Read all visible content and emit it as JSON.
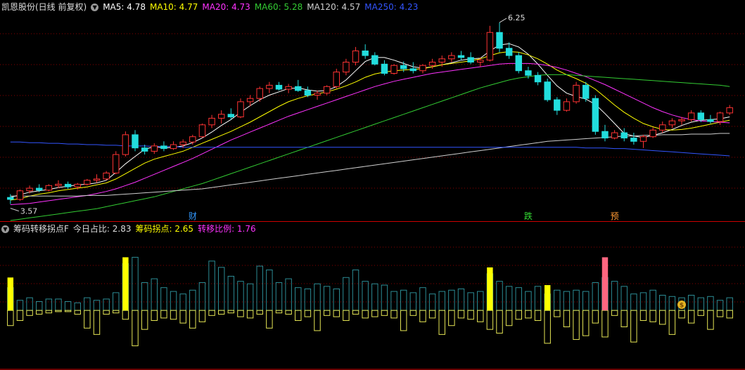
{
  "stock_title": "凯恩股份(日线 前复权)",
  "ma_legend": [
    {
      "label": "MA5: 4.78",
      "color": "#ffffff"
    },
    {
      "label": "MA10: 4.77",
      "color": "#ffff00"
    },
    {
      "label": "MA20: 4.73",
      "color": "#ff33ff"
    },
    {
      "label": "MA60: 5.28",
      "color": "#33cc33"
    },
    {
      "label": "MA120: 4.57",
      "color": "#cfcfcf"
    },
    {
      "label": "MA250: 4.23",
      "color": "#3355ff"
    }
  ],
  "indicator_title": "筹码转移拐点F",
  "indicator_legend": [
    {
      "label": "今日占比: 2.83",
      "color": "#dddddd"
    },
    {
      "label": "筹码拐点: 2.65",
      "color": "#ffff00"
    },
    {
      "label": "转移比例: 1.76",
      "color": "#ff33ff"
    }
  ],
  "annotations": {
    "high_label": "6.25",
    "low_label": "3.57",
    "markers": [
      {
        "text": "财",
        "index": 19,
        "color": "#3399ff"
      },
      {
        "text": "跌",
        "index": 54,
        "color": "#33dd33"
      },
      {
        "text": "预",
        "index": 63,
        "color": "#ff9933"
      }
    ]
  },
  "colors": {
    "up": "#ff3333",
    "down": "#22dddd",
    "grid": "#880000",
    "divider": "#cc0000"
  },
  "icons": {
    "collapse": "chevron-down-icon",
    "money_bag": "money-bag-icon"
  },
  "chart_data": [
    {
      "type": "candlestick",
      "name": "price",
      "ylim": [
        3.4,
        6.4
      ],
      "candles": [
        [
          3.6,
          3.65,
          3.5,
          3.57
        ],
        [
          3.57,
          3.72,
          3.55,
          3.7
        ],
        [
          3.7,
          3.78,
          3.66,
          3.74
        ],
        [
          3.74,
          3.8,
          3.68,
          3.71
        ],
        [
          3.71,
          3.8,
          3.69,
          3.78
        ],
        [
          3.78,
          3.86,
          3.74,
          3.8
        ],
        [
          3.8,
          3.84,
          3.73,
          3.76
        ],
        [
          3.76,
          3.82,
          3.72,
          3.8
        ],
        [
          3.8,
          3.88,
          3.78,
          3.86
        ],
        [
          3.86,
          3.95,
          3.82,
          3.88
        ],
        [
          3.88,
          4.0,
          3.86,
          3.97
        ],
        [
          3.97,
          4.3,
          3.95,
          4.25
        ],
        [
          4.25,
          4.6,
          4.22,
          4.55
        ],
        [
          4.55,
          4.62,
          4.3,
          4.35
        ],
        [
          4.35,
          4.4,
          4.25,
          4.3
        ],
        [
          4.3,
          4.42,
          4.26,
          4.38
        ],
        [
          4.38,
          4.45,
          4.3,
          4.34
        ],
        [
          4.34,
          4.45,
          4.32,
          4.4
        ],
        [
          4.4,
          4.48,
          4.35,
          4.44
        ],
        [
          4.44,
          4.55,
          4.4,
          4.52
        ],
        [
          4.52,
          4.72,
          4.5,
          4.7
        ],
        [
          4.7,
          4.85,
          4.65,
          4.8
        ],
        [
          4.8,
          4.92,
          4.72,
          4.86
        ],
        [
          4.86,
          4.95,
          4.78,
          4.82
        ],
        [
          4.82,
          5.1,
          4.8,
          5.05
        ],
        [
          5.05,
          5.15,
          4.98,
          5.1
        ],
        [
          5.1,
          5.28,
          5.05,
          5.25
        ],
        [
          5.25,
          5.35,
          5.18,
          5.3
        ],
        [
          5.3,
          5.35,
          5.22,
          5.24
        ],
        [
          5.24,
          5.32,
          5.18,
          5.28
        ],
        [
          5.28,
          5.38,
          5.2,
          5.22
        ],
        [
          5.22,
          5.28,
          5.12,
          5.15
        ],
        [
          5.15,
          5.22,
          5.08,
          5.18
        ],
        [
          5.18,
          5.3,
          5.15,
          5.28
        ],
        [
          5.28,
          5.55,
          5.25,
          5.5
        ],
        [
          5.5,
          5.7,
          5.45,
          5.65
        ],
        [
          5.65,
          5.88,
          5.6,
          5.82
        ],
        [
          5.82,
          5.92,
          5.7,
          5.75
        ],
        [
          5.75,
          5.8,
          5.6,
          5.62
        ],
        [
          5.62,
          5.68,
          5.45,
          5.48
        ],
        [
          5.48,
          5.62,
          5.46,
          5.6
        ],
        [
          5.6,
          5.66,
          5.5,
          5.55
        ],
        [
          5.55,
          5.65,
          5.48,
          5.52
        ],
        [
          5.52,
          5.62,
          5.48,
          5.6
        ],
        [
          5.6,
          5.7,
          5.55,
          5.65
        ],
        [
          5.65,
          5.75,
          5.58,
          5.7
        ],
        [
          5.7,
          5.8,
          5.65,
          5.75
        ],
        [
          5.75,
          5.82,
          5.68,
          5.72
        ],
        [
          5.72,
          5.8,
          5.62,
          5.65
        ],
        [
          5.65,
          5.72,
          5.58,
          5.68
        ],
        [
          5.68,
          6.2,
          5.66,
          6.1
        ],
        [
          6.1,
          6.25,
          5.8,
          5.86
        ],
        [
          5.86,
          5.95,
          5.7,
          5.75
        ],
        [
          5.75,
          5.8,
          5.48,
          5.52
        ],
        [
          5.52,
          5.58,
          5.4,
          5.45
        ],
        [
          5.45,
          5.5,
          5.3,
          5.35
        ],
        [
          5.35,
          5.4,
          5.05,
          5.08
        ],
        [
          5.08,
          5.12,
          4.85,
          4.92
        ],
        [
          4.92,
          5.1,
          4.9,
          5.05
        ],
        [
          5.05,
          5.35,
          5.02,
          5.3
        ],
        [
          5.3,
          5.35,
          5.05,
          5.1
        ],
        [
          5.1,
          5.15,
          4.55,
          4.6
        ],
        [
          4.6,
          4.7,
          4.45,
          4.5
        ],
        [
          4.5,
          4.62,
          4.48,
          4.58
        ],
        [
          4.58,
          4.65,
          4.45,
          4.5
        ],
        [
          4.5,
          4.58,
          4.4,
          4.45
        ],
        [
          4.45,
          4.55,
          4.35,
          4.52
        ],
        [
          4.52,
          4.66,
          4.5,
          4.62
        ],
        [
          4.62,
          4.75,
          4.58,
          4.7
        ],
        [
          4.7,
          4.8,
          4.65,
          4.76
        ],
        [
          4.76,
          4.82,
          4.7,
          4.78
        ],
        [
          4.78,
          4.92,
          4.75,
          4.88
        ],
        [
          4.88,
          4.92,
          4.74,
          4.78
        ],
        [
          4.78,
          4.85,
          4.72,
          4.75
        ],
        [
          4.75,
          4.9,
          4.7,
          4.88
        ],
        [
          4.88,
          5.0,
          4.85,
          4.96
        ]
      ],
      "ma_series": [
        {
          "name": "MA5",
          "color": "#ffffff",
          "values": [
            3.6,
            3.64,
            3.68,
            3.7,
            3.72,
            3.75,
            3.77,
            3.79,
            3.8,
            3.82,
            3.86,
            3.98,
            4.11,
            4.22,
            4.33,
            4.37,
            4.35,
            4.36,
            4.38,
            4.43,
            4.5,
            4.59,
            4.69,
            4.78,
            4.89,
            4.99,
            5.08,
            5.15,
            5.2,
            5.25,
            5.26,
            5.23,
            5.21,
            5.22,
            5.28,
            5.38,
            5.52,
            5.66,
            5.72,
            5.72,
            5.68,
            5.63,
            5.58,
            5.56,
            5.58,
            5.61,
            5.64,
            5.68,
            5.7,
            5.71,
            5.82,
            5.91,
            5.93,
            5.88,
            5.77,
            5.62,
            5.45,
            5.29,
            5.18,
            5.13,
            5.09,
            5.01,
            4.87,
            4.72,
            4.57,
            4.53,
            4.51,
            4.54,
            4.58,
            4.63,
            4.69,
            4.74,
            4.77,
            4.78,
            4.79,
            4.82
          ]
        },
        {
          "name": "MA10",
          "color": "#ffff00",
          "values": [
            3.56,
            3.58,
            3.62,
            3.65,
            3.67,
            3.7,
            3.72,
            3.74,
            3.76,
            3.79,
            3.82,
            3.88,
            3.96,
            4.04,
            4.12,
            4.18,
            4.22,
            4.26,
            4.3,
            4.36,
            4.42,
            4.48,
            4.54,
            4.6,
            4.67,
            4.74,
            4.82,
            4.9,
            4.98,
            5.05,
            5.1,
            5.14,
            5.17,
            5.2,
            5.24,
            5.29,
            5.35,
            5.42,
            5.47,
            5.5,
            5.52,
            5.53,
            5.54,
            5.55,
            5.58,
            5.61,
            5.63,
            5.65,
            5.67,
            5.7,
            5.75,
            5.79,
            5.81,
            5.8,
            5.76,
            5.7,
            5.62,
            5.53,
            5.46,
            5.4,
            5.33,
            5.24,
            5.12,
            5.0,
            4.89,
            4.8,
            4.72,
            4.67,
            4.63,
            4.62,
            4.63,
            4.65,
            4.68,
            4.71,
            4.74,
            4.77
          ]
        },
        {
          "name": "MA20",
          "color": "#ff33ff",
          "values": [
            3.49,
            3.5,
            3.51,
            3.53,
            3.55,
            3.57,
            3.59,
            3.61,
            3.63,
            3.66,
            3.69,
            3.73,
            3.78,
            3.83,
            3.89,
            3.95,
            4.01,
            4.07,
            4.13,
            4.19,
            4.26,
            4.33,
            4.4,
            4.47,
            4.53,
            4.59,
            4.65,
            4.71,
            4.77,
            4.83,
            4.88,
            4.93,
            4.98,
            5.03,
            5.08,
            5.13,
            5.18,
            5.23,
            5.28,
            5.32,
            5.36,
            5.39,
            5.42,
            5.45,
            5.48,
            5.5,
            5.52,
            5.54,
            5.56,
            5.58,
            5.6,
            5.62,
            5.63,
            5.63,
            5.63,
            5.62,
            5.6,
            5.57,
            5.53,
            5.48,
            5.43,
            5.37,
            5.31,
            5.24,
            5.17,
            5.1,
            5.03,
            4.96,
            4.9,
            4.85,
            4.81,
            4.78,
            4.76,
            4.75,
            4.74,
            4.73
          ]
        },
        {
          "name": "MA60",
          "color": "#33cc33",
          "values": [
            3.25,
            3.27,
            3.29,
            3.31,
            3.33,
            3.35,
            3.37,
            3.39,
            3.41,
            3.43,
            3.46,
            3.49,
            3.52,
            3.55,
            3.58,
            3.61,
            3.65,
            3.69,
            3.73,
            3.77,
            3.81,
            3.86,
            3.91,
            3.96,
            4.01,
            4.06,
            4.11,
            4.16,
            4.21,
            4.26,
            4.31,
            4.36,
            4.41,
            4.46,
            4.51,
            4.56,
            4.61,
            4.66,
            4.71,
            4.76,
            4.81,
            4.86,
            4.91,
            4.96,
            5.01,
            5.06,
            5.11,
            5.16,
            5.21,
            5.26,
            5.3,
            5.34,
            5.38,
            5.41,
            5.43,
            5.45,
            5.46,
            5.46,
            5.46,
            5.45,
            5.44,
            5.43,
            5.42,
            5.41,
            5.4,
            5.39,
            5.38,
            5.37,
            5.36,
            5.35,
            5.34,
            5.33,
            5.32,
            5.31,
            5.3,
            5.28
          ]
        },
        {
          "name": "MA120",
          "color": "#cfcfcf",
          "values": [
            3.62,
            3.62,
            3.62,
            3.62,
            3.62,
            3.62,
            3.62,
            3.62,
            3.63,
            3.63,
            3.63,
            3.64,
            3.65,
            3.66,
            3.67,
            3.68,
            3.69,
            3.7,
            3.71,
            3.72,
            3.73,
            3.75,
            3.77,
            3.79,
            3.81,
            3.83,
            3.85,
            3.87,
            3.89,
            3.91,
            3.93,
            3.95,
            3.97,
            3.99,
            4.01,
            4.03,
            4.05,
            4.07,
            4.09,
            4.11,
            4.13,
            4.15,
            4.17,
            4.19,
            4.21,
            4.23,
            4.25,
            4.27,
            4.29,
            4.31,
            4.33,
            4.35,
            4.37,
            4.39,
            4.41,
            4.43,
            4.45,
            4.46,
            4.47,
            4.48,
            4.49,
            4.5,
            4.51,
            4.52,
            4.53,
            4.53,
            4.54,
            4.54,
            4.55,
            4.55,
            4.55,
            4.56,
            4.56,
            4.56,
            4.57,
            4.57
          ]
        },
        {
          "name": "MA250",
          "color": "#3355ff",
          "values": [
            4.44,
            4.44,
            4.43,
            4.43,
            4.42,
            4.42,
            4.41,
            4.41,
            4.4,
            4.4,
            4.39,
            4.39,
            4.38,
            4.38,
            4.38,
            4.37,
            4.37,
            4.37,
            4.36,
            4.36,
            4.36,
            4.36,
            4.36,
            4.36,
            4.36,
            4.36,
            4.36,
            4.36,
            4.36,
            4.36,
            4.36,
            4.36,
            4.36,
            4.36,
            4.36,
            4.36,
            4.36,
            4.36,
            4.36,
            4.36,
            4.36,
            4.36,
            4.36,
            4.36,
            4.36,
            4.36,
            4.36,
            4.36,
            4.36,
            4.36,
            4.36,
            4.36,
            4.36,
            4.36,
            4.36,
            4.36,
            4.36,
            4.36,
            4.36,
            4.36,
            4.35,
            4.35,
            4.35,
            4.34,
            4.34,
            4.33,
            4.32,
            4.31,
            4.3,
            4.29,
            4.28,
            4.27,
            4.26,
            4.25,
            4.24,
            4.23
          ]
        }
      ]
    },
    {
      "type": "bar",
      "name": "chip-transfer-indicator",
      "ylim": [
        -4.6,
        6.0
      ],
      "up": [
        1.8,
        0.8,
        1.0,
        0.7,
        0.9,
        0.9,
        0.7,
        0.6,
        1.0,
        0.8,
        0.9,
        1.4,
        3.7,
        4.2,
        2.2,
        2.5,
        1.8,
        1.5,
        1.3,
        1.6,
        2.2,
        3.9,
        3.4,
        2.7,
        2.3,
        2.1,
        3.5,
        3.2,
        2.2,
        2.5,
        1.8,
        1.7,
        2.1,
        1.9,
        1.7,
        2.6,
        3.2,
        2.3,
        2.1,
        2.0,
        1.5,
        1.6,
        1.4,
        1.8,
        1.3,
        1.5,
        1.6,
        1.7,
        1.4,
        1.5,
        2.9,
        2.3,
        1.9,
        1.8,
        1.5,
        1.9,
        1.3,
        1.6,
        1.5,
        1.6,
        1.5,
        2.2,
        2.6,
        2.3,
        1.9,
        1.3,
        1.4,
        1.6,
        1.2,
        1.1,
        1.0,
        1.2,
        1.0,
        1.1,
        0.8,
        1.0
      ],
      "down": [
        -1.2,
        -0.8,
        -0.4,
        -0.3,
        -0.2,
        -0.1,
        -0.1,
        -0.3,
        -1.4,
        -1.9,
        -0.3,
        -0.2,
        -0.7,
        -2.8,
        -1.5,
        -0.8,
        -0.6,
        -0.7,
        -1.0,
        -1.4,
        -0.9,
        -0.4,
        -0.3,
        -0.2,
        -0.5,
        -0.6,
        -0.3,
        -1.4,
        -0.2,
        -0.3,
        -0.8,
        -0.5,
        -1.6,
        -0.4,
        -0.5,
        -0.8,
        -0.3,
        -0.6,
        -0.5,
        -0.4,
        -0.6,
        -1.6,
        -0.4,
        -0.9,
        -0.6,
        -1.9,
        -1.2,
        -0.6,
        -0.7,
        -0.9,
        -1.5,
        -1.8,
        -1.2,
        -0.7,
        -0.6,
        -0.8,
        -2.6,
        -0.5,
        -1.3,
        -2.3,
        -2.0,
        -1.0,
        -2.1,
        -0.4,
        -1.3,
        -2.5,
        -0.8,
        -0.9,
        -1.1,
        -1.9,
        -0.6,
        -1.0,
        -0.4,
        -1.5,
        -0.5,
        -0.6
      ],
      "highlight": [
        {
          "index": 0,
          "value": 2.6,
          "color": "#ffff00"
        },
        {
          "index": 12,
          "value": 4.2,
          "color": "#ffff00"
        },
        {
          "index": 50,
          "value": 3.4,
          "color": "#ffff00"
        },
        {
          "index": 56,
          "value": 2.0,
          "color": "#ffff00"
        },
        {
          "index": 62,
          "value": 4.2,
          "color": "#ff6680"
        }
      ]
    }
  ]
}
